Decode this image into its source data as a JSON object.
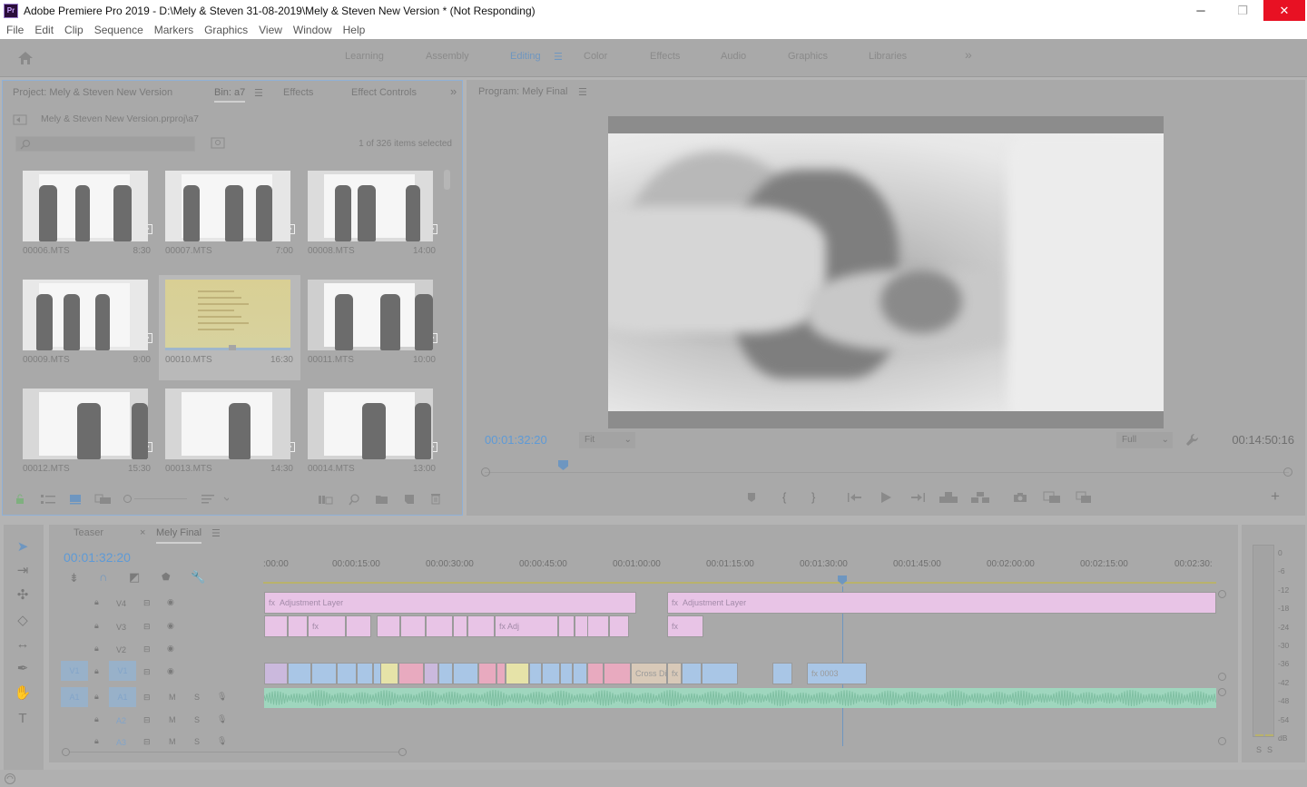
{
  "window": {
    "title": "Adobe Premiere Pro 2019 - D:\\Mely & Steven 31-08-2019\\Mely & Steven New Version * (Not Responding)",
    "app_icon": "Pr",
    "min": "─",
    "max": "❐",
    "close": "✕"
  },
  "menu": [
    "File",
    "Edit",
    "Clip",
    "Sequence",
    "Markers",
    "Graphics",
    "View",
    "Window",
    "Help"
  ],
  "workspaces": {
    "tabs": [
      "Learning",
      "Assembly",
      "Editing",
      "Color",
      "Effects",
      "Audio",
      "Graphics",
      "Libraries"
    ],
    "active": "Editing",
    "more": "»"
  },
  "project": {
    "tabs": [
      "Project: Mely & Steven New Version",
      "Bin: a7",
      "Effects",
      "Effect Controls"
    ],
    "more": "»",
    "path": "Mely & Steven New Version.prproj\\a7",
    "items_selected": "1 of 326 items selected",
    "clips": [
      {
        "name": "00006.MTS",
        "duration": "8:30"
      },
      {
        "name": "00007.MTS",
        "duration": "7:00"
      },
      {
        "name": "00008.MTS",
        "duration": "14:00"
      },
      {
        "name": "00009.MTS",
        "duration": "9:00"
      },
      {
        "name": "00010.MTS",
        "duration": "16:30"
      },
      {
        "name": "00011.MTS",
        "duration": "10:00"
      },
      {
        "name": "00012.MTS",
        "duration": "15:30"
      },
      {
        "name": "00013.MTS",
        "duration": "14:30"
      },
      {
        "name": "00014.MTS",
        "duration": "13:00"
      }
    ],
    "selected_index": 4
  },
  "program": {
    "title": "Program: Mely Final",
    "current_timecode": "00:01:32:20",
    "total_timecode": "00:14:50:16",
    "zoom": "Fit",
    "resolution": "Full",
    "colors": {
      "timecode": "#5e9ad6"
    }
  },
  "timeline": {
    "tabs": [
      "Teaser",
      "Mely Final"
    ],
    "active_tab": "Mely Final",
    "timecode": "00:01:32:20",
    "ruler": [
      ":00:00",
      "00:00:15:00",
      "00:00:30:00",
      "00:00:45:00",
      "00:01:00:00",
      "00:01:15:00",
      "00:01:30:00",
      "00:01:45:00",
      "00:02:00:00",
      "00:02:15:00",
      "00:02:30:"
    ],
    "video_tracks": [
      "V4",
      "V3",
      "V2",
      "V1"
    ],
    "audio_tracks": [
      "A1",
      "A2",
      "A3"
    ],
    "source_v": "V1",
    "source_a": "A1",
    "adjustment_label": "Adjustment Layer",
    "clip_labels": {
      "adj_short": "Adj",
      "cross_dissolve": "Cross Di",
      "clip_0003": "0003",
      "fx": "fx"
    },
    "mute": "M",
    "solo": "S"
  },
  "meters": {
    "scale": [
      "0",
      "-6",
      "-12",
      "-18",
      "-24",
      "-30",
      "-36",
      "-42",
      "-48",
      "-54",
      "dB"
    ],
    "solo": [
      "S",
      "S"
    ]
  }
}
